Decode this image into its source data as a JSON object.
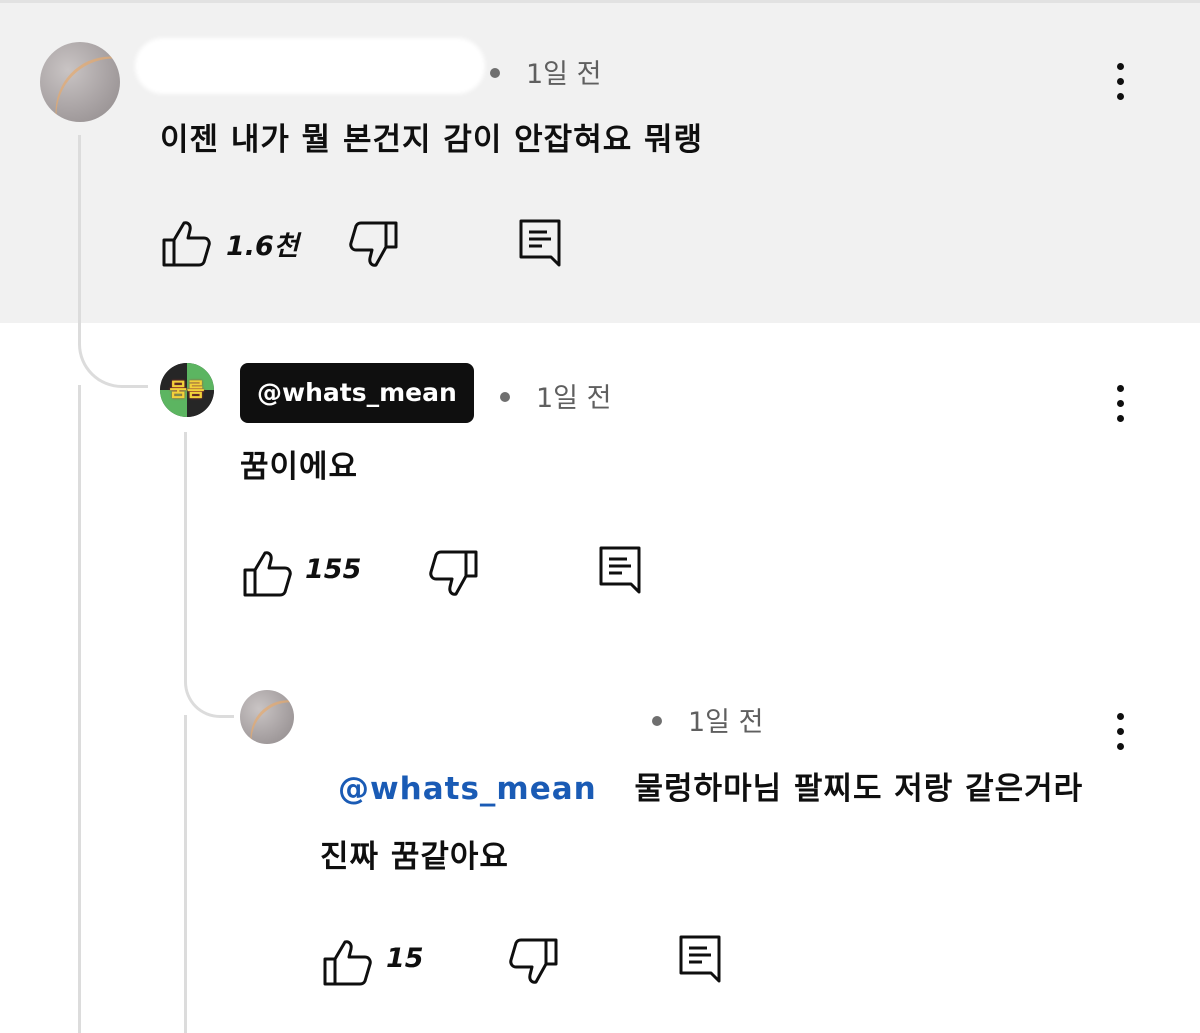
{
  "comments": [
    {
      "author_redacted": true,
      "timestamp": "1일 전",
      "text": "이젠 내가 뭘 본건지 감이 안잡혀요 뭐랭",
      "likes": "1.6천",
      "highlighted": true
    },
    {
      "author": "@whats_mean",
      "avatar_text": "뭄름",
      "timestamp": "1일 전",
      "text": "꿈이에요",
      "likes": "155"
    },
    {
      "author_redacted": true,
      "timestamp": "1일 전",
      "mention": "@whats_mean",
      "text_line1": "물렁하마님 팔찌도 저랑 같은거라",
      "text_line2": "진짜 꿈같아요",
      "likes": "15"
    }
  ],
  "icons": {
    "like": "thumbs-up-icon",
    "dislike": "thumbs-down-icon",
    "reply": "reply-icon",
    "more": "more-vert-icon"
  },
  "colors": {
    "highlight_bg": "#f1f1f1",
    "mention_link": "#1a5bb5",
    "author_chip_bg": "#0f0f0f"
  }
}
